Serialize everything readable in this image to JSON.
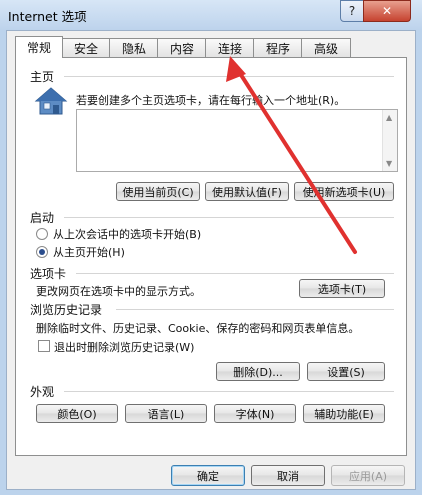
{
  "window": {
    "title": "Internet 选项",
    "help_glyph": "?",
    "close_glyph": "✕"
  },
  "tabs": [
    "常规",
    "安全",
    "隐私",
    "内容",
    "连接",
    "程序",
    "高级"
  ],
  "home": {
    "heading": "主页",
    "description": "若要创建多个主页选项卡，请在每行输入一个地址(R)。",
    "buttons": [
      "使用当前页(C)",
      "使用默认值(F)",
      "使用新选项卡(U)"
    ]
  },
  "startup": {
    "heading": "启动",
    "options": [
      "从上次会话中的选项卡开始(B)",
      "从主页开始(H)"
    ],
    "selected_index": 1
  },
  "tabs_section": {
    "heading": "选项卡",
    "description": "更改网页在选项卡中的显示方式。",
    "button": "选项卡(T)"
  },
  "history": {
    "heading": "浏览历史记录",
    "description": "删除临时文件、历史记录、Cookie、保存的密码和网页表单信息。",
    "checkbox_label": "退出时删除浏览历史记录(W)",
    "checkbox_checked": false,
    "delete_button": "删除(D)...",
    "settings_button": "设置(S)"
  },
  "appearance": {
    "heading": "外观",
    "buttons": [
      "颜色(O)",
      "语言(L)",
      "字体(N)",
      "辅助功能(E)"
    ]
  },
  "footer": {
    "ok": "确定",
    "cancel": "取消",
    "apply": "应用(A)"
  },
  "annotation_color": "#e0312f"
}
